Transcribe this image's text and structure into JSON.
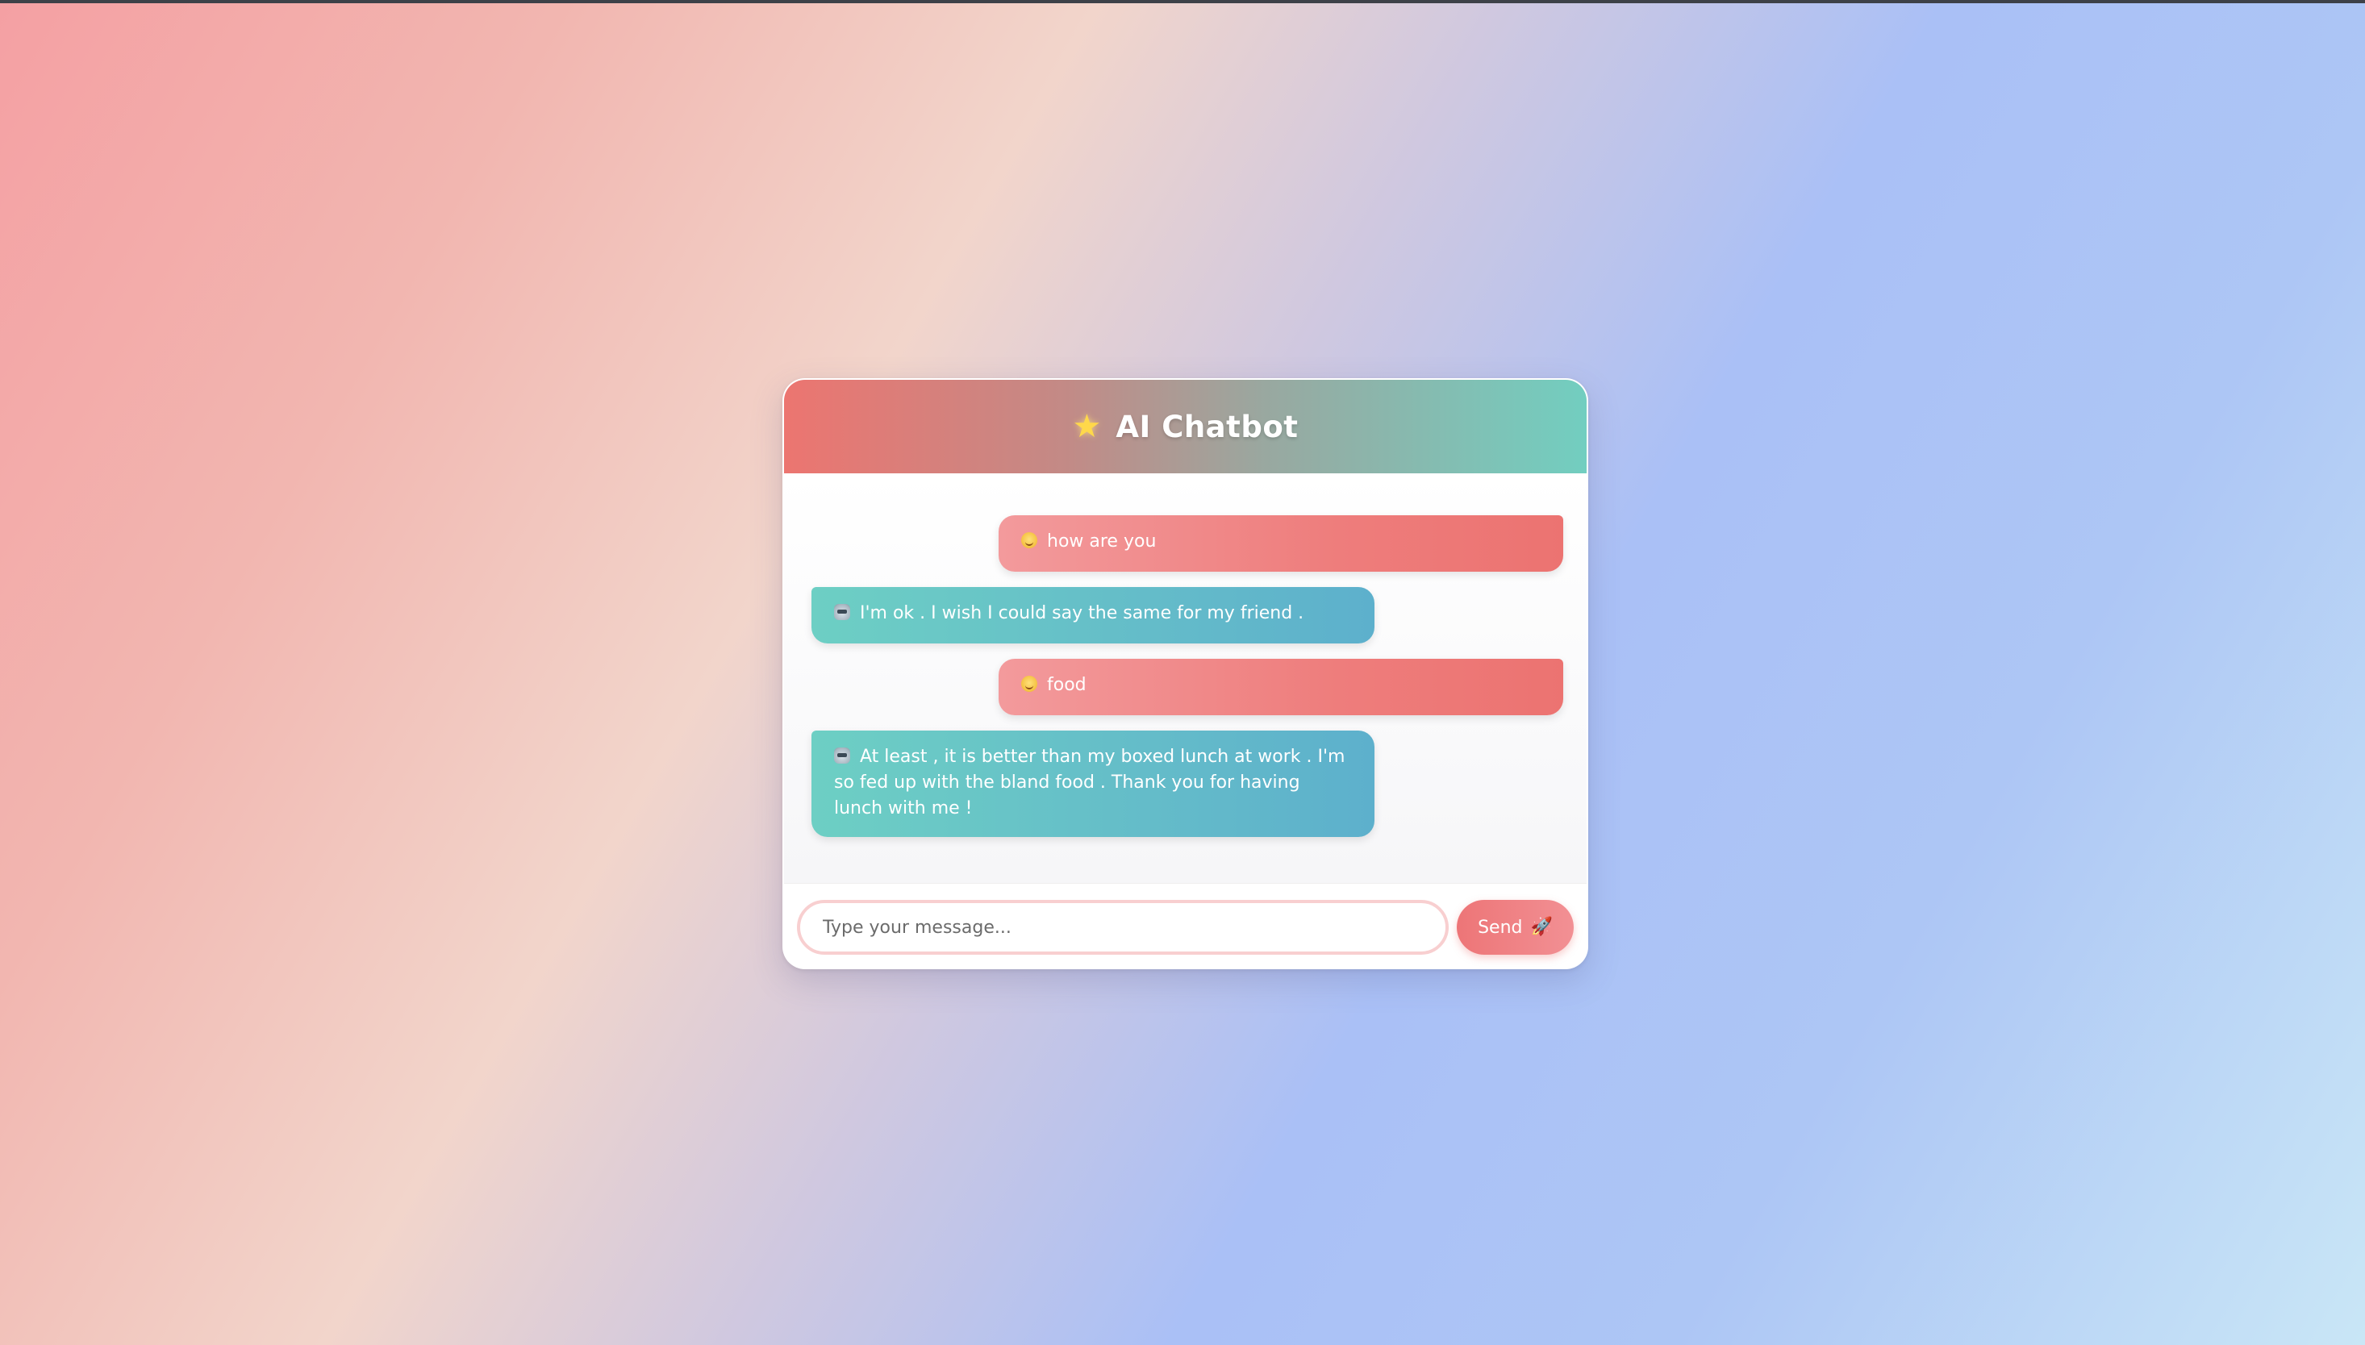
{
  "header": {
    "icon": "star-icon",
    "icon_glyph": "★",
    "title": "AI Chatbot"
  },
  "messages": [
    {
      "sender": "user",
      "icon": "smiling-face-icon",
      "text": "how are you"
    },
    {
      "sender": "bot",
      "icon": "robot-icon",
      "text": "I'm ok . I wish I could say the same for my friend ."
    },
    {
      "sender": "user",
      "icon": "smiling-face-icon",
      "text": "food"
    },
    {
      "sender": "bot",
      "icon": "robot-icon",
      "text": "At least , it is better than my boxed lunch at work . I'm so fed up with the bland food . Thank you for having lunch with me !"
    }
  ],
  "composer": {
    "placeholder": "Type your message...",
    "value": "",
    "send_label": "Send",
    "send_icon": "rocket-icon",
    "send_glyph": "🚀"
  },
  "colors": {
    "user_bubble": "#ee7d7c",
    "bot_bubble": "#64bcc9",
    "header_start": "#ec7570",
    "header_end": "#72cec0",
    "send_button": "#ed7577"
  }
}
